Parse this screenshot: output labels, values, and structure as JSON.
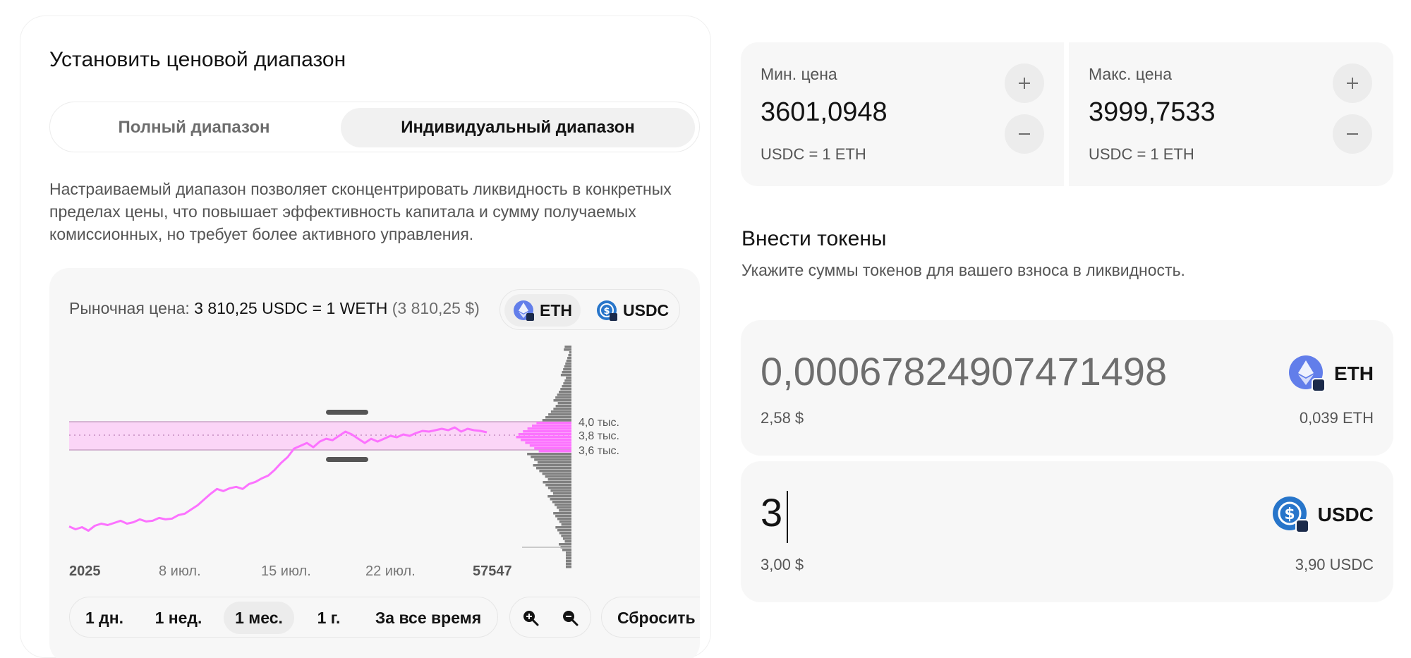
{
  "left": {
    "title": "Установить ценовой диапазон",
    "toggle": {
      "full": "Полный диапазон",
      "custom": "Индивидуальный диапазон",
      "selected": "custom"
    },
    "description": "Настраиваемый диапазон позволяет сконцентрировать ликвидность в конкретных пределах цены, что повышает эффективность капитала и сумму получаемых комиссионных, но требует более активного управления.",
    "market_price": {
      "label": "Рыночная цена:",
      "value": "3 810,25 USDC = 1 WETH",
      "usd": "(3 810,25 $)"
    },
    "token_switch": {
      "eth": "ETH",
      "usdc": "USDC"
    },
    "time_buttons": {
      "day": "1 дн.",
      "week": "1 нед.",
      "month": "1 мес.",
      "year": "1 г.",
      "all": "За все время",
      "selected": "month"
    },
    "reset": "Сбросить"
  },
  "chart_data": {
    "type": "line",
    "x_tick_labels": [
      "2025",
      "8 июл.",
      "15 июл.",
      "22 июл.",
      "57547"
    ],
    "y_tick_labels": [
      "4,0 тыс.",
      "3,8 тыс.",
      "3,6 тыс."
    ],
    "range_min": 3601.0948,
    "range_max": 3999.7533,
    "current_price": 3810.25,
    "line_color": "#fc72ff",
    "range_fill": "#fbd5f7",
    "series": [
      {
        "values": [
          2520,
          2480,
          2510,
          2460,
          2530,
          2560,
          2540,
          2570,
          2600,
          2560,
          2580,
          2620,
          2590,
          2600,
          2640,
          2620,
          2630,
          2680,
          2700,
          2760,
          2820,
          2900,
          2980,
          3050,
          3020,
          3060,
          3080,
          3050,
          3120,
          3150,
          3200,
          3240,
          3320,
          3420,
          3500,
          3620,
          3660,
          3700,
          3640,
          3720,
          3760,
          3740,
          3800,
          3860,
          3820,
          3760,
          3700,
          3760,
          3720,
          3760,
          3800,
          3780,
          3820,
          3800,
          3840,
          3870,
          3860,
          3880,
          3900,
          3880,
          3920,
          3860,
          3900,
          3880,
          3870,
          3850
        ]
      }
    ]
  },
  "right": {
    "min": {
      "label": "Мин. цена",
      "value": "3601,0948",
      "unit": "USDC = 1 ETH"
    },
    "max": {
      "label": "Макс. цена",
      "value": "3999,7533",
      "unit": "USDC = 1 ETH"
    },
    "deposit_title": "Внести токены",
    "deposit_sub": "Укажите суммы токенов для вашего взноса в ликвидность.",
    "eth": {
      "amount": "0,00067824907471498",
      "usd": "2,58 $",
      "balance": "0,039 ETH",
      "token": "ETH"
    },
    "usdc": {
      "amount": "3",
      "usd": "3,00 $",
      "balance": "3,90 USDC",
      "token": "USDC"
    }
  },
  "colors": {
    "accent": "#fc72ff",
    "eth": "#627eea",
    "usdc": "#2775ca"
  }
}
